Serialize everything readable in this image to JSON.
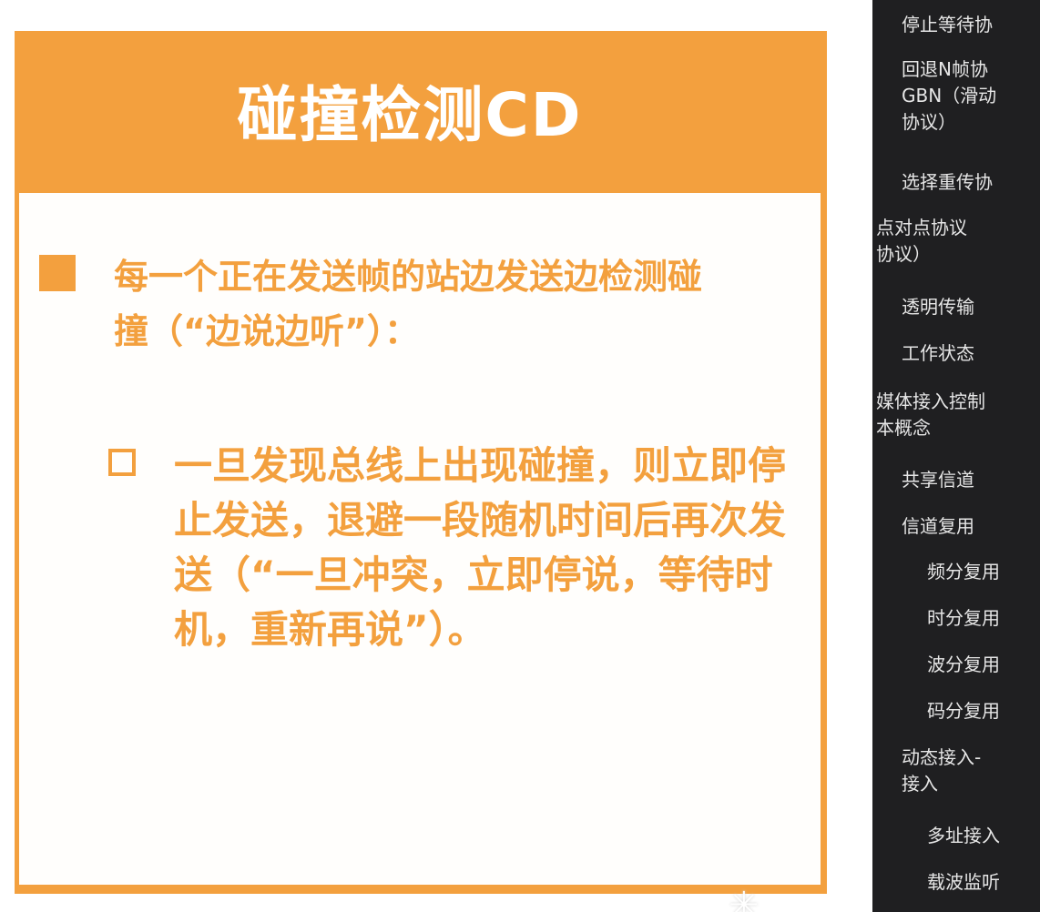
{
  "slide": {
    "title": "碰撞检测CD",
    "bullet1": "每一个正在发送帧的站边发送边检测碰撞（“边说边听”）：",
    "bullet2": "一旦发现总线上出现碰撞，则立即停止发送，退避一段随机时间后再次发送（“一旦冲突，立即停说，等待时机，重新再说”）。",
    "accent_color": "#f3a03e"
  },
  "sidebar": {
    "background": "#1f1f21",
    "items": [
      {
        "id": "stop-wait",
        "lines": [
          "停止等待协"
        ]
      },
      {
        "id": "gbn",
        "lines": [
          "回退N帧协",
          "GBN（滑动",
          "协议）"
        ]
      },
      {
        "id": "sr",
        "lines": [
          "选择重传协"
        ]
      },
      {
        "id": "ppp",
        "lines": [
          "点对点协议",
          "协议）"
        ]
      },
      {
        "id": "transparent",
        "lines": [
          "透明传输"
        ]
      },
      {
        "id": "working-state",
        "lines": [
          "工作状态"
        ]
      },
      {
        "id": "mac-concepts",
        "lines": [
          "媒体接入控制",
          "本概念"
        ]
      },
      {
        "id": "shared-channel",
        "lines": [
          "共享信道"
        ]
      },
      {
        "id": "multiplexing",
        "lines": [
          "信道复用"
        ]
      },
      {
        "id": "fdm",
        "lines": [
          "频分复用"
        ]
      },
      {
        "id": "tdm",
        "lines": [
          "时分复用"
        ]
      },
      {
        "id": "wdm",
        "lines": [
          "波分复用"
        ]
      },
      {
        "id": "cdm",
        "lines": [
          "码分复用"
        ]
      },
      {
        "id": "dynamic-access",
        "lines": [
          "动态接入-",
          "接入"
        ]
      },
      {
        "id": "multiple-access",
        "lines": [
          "多址接入"
        ]
      },
      {
        "id": "carrier-sense",
        "lines": [
          "载波监听"
        ]
      }
    ]
  },
  "icons": {
    "loading": "loading-spinner-icon"
  }
}
